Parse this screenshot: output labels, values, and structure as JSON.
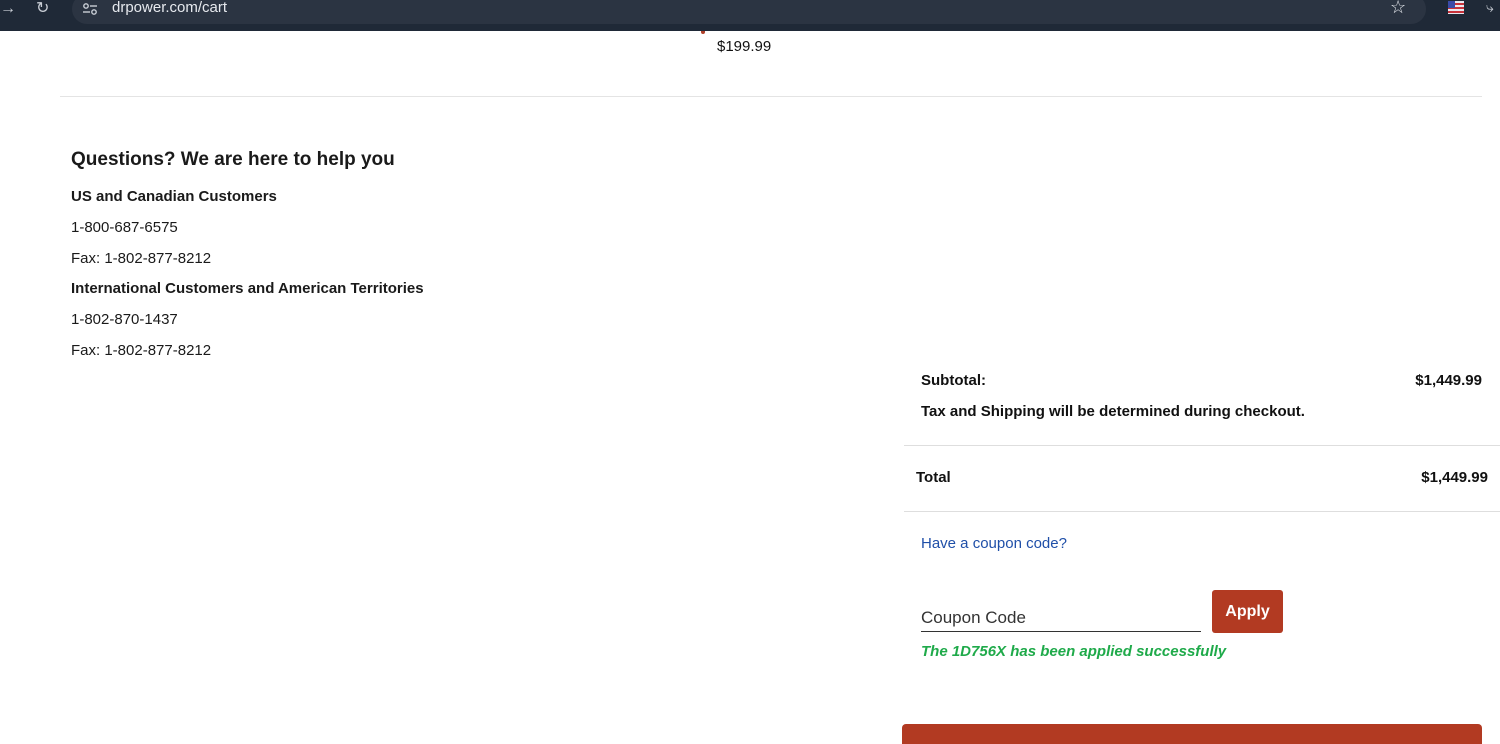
{
  "browser": {
    "url": "drpower.com/cart",
    "icons": {
      "back": "arrow-right-icon",
      "reload": "reload-icon",
      "site_info": "site-info-icon",
      "bookmark": "star-icon",
      "extension": "flag-extension-icon",
      "extensions_menu": "puzzle-icon"
    }
  },
  "cart_item": {
    "price": "$199.99"
  },
  "help": {
    "title": "Questions? We are here to help you",
    "us_heading": "US and Canadian Customers",
    "us_phone": "1-800-687-6575",
    "us_fax": "Fax: 1-802-877-8212",
    "intl_heading": "International Customers and American Territories",
    "intl_phone": "1-802-870-1437",
    "intl_fax": "Fax: 1-802-877-8212"
  },
  "summary": {
    "subtotal_label": "Subtotal:",
    "subtotal_value": "$1,449.99",
    "tax_note": "Tax and Shipping will be determined during checkout.",
    "total_label": "Total",
    "total_value": "$1,449.99"
  },
  "coupon": {
    "toggle_label": "Have a coupon code?",
    "placeholder": "Coupon Code",
    "apply_label": "Apply",
    "success_message": "The 1D756X has been applied successfully"
  },
  "colors": {
    "accent": "#b23a22",
    "link": "#1f4fa8",
    "success": "#1faa4a",
    "browser_bar": "#1f2937"
  }
}
